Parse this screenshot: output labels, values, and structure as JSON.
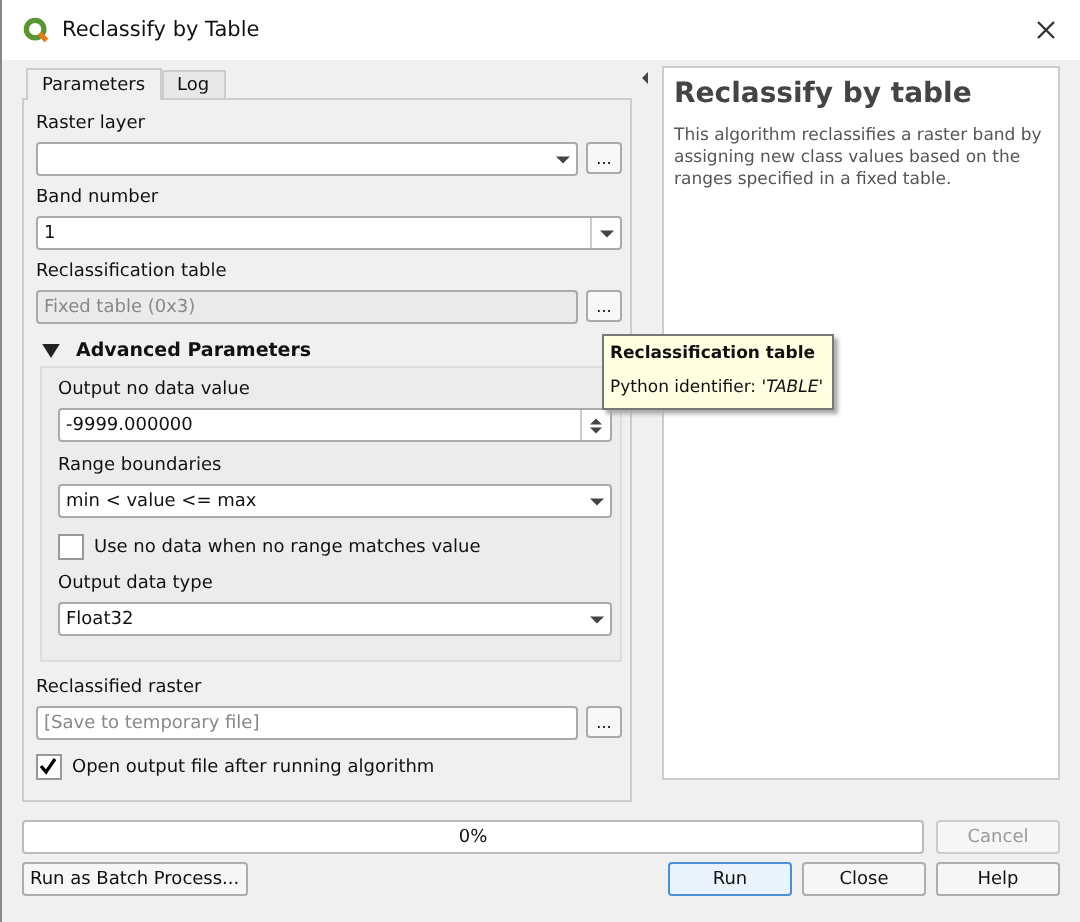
{
  "window": {
    "title": "Reclassify by Table"
  },
  "tabs": [
    {
      "label": "Parameters",
      "selected": true
    },
    {
      "label": "Log",
      "selected": false
    }
  ],
  "parameters": [
    {
      "kind": "combo",
      "label": "Raster layer",
      "browse": "..."
    },
    {
      "kind": "combo",
      "label": "Band number",
      "value": "1"
    },
    {
      "kind": "text",
      "label": "Reclassification table",
      "placeholder": "Fixed table (0x3)",
      "browse": "..."
    }
  ],
  "advanced": {
    "title": "Advanced Parameters",
    "expanded": true,
    "items": [
      {
        "kind": "spin",
        "label": "Output no data value",
        "value": "-9999.000000"
      },
      {
        "kind": "combo",
        "label": "Range boundaries",
        "value": "min < value <= max"
      },
      {
        "kind": "check",
        "label": "Use no data when no range matches value",
        "checked": false
      },
      {
        "kind": "combo",
        "label": "Output data type",
        "value": "Float32"
      }
    ]
  },
  "output": {
    "label": "Reclassified raster",
    "placeholder": "[Save to temporary file]",
    "browse": "..."
  },
  "open_output": {
    "label": "Open output file after running algorithm",
    "checked": true
  },
  "help": {
    "title": "Reclassify by table",
    "text": "This algorithm reclassifies a raster band by assigning new class values based on the ranges specified in a fixed table."
  },
  "tooltip": {
    "title": "Reclassification table",
    "text": "Python identifier: *'TABLE'*"
  },
  "progress": {
    "level": 0,
    "reading": "0%"
  },
  "buttons": [
    {
      "label": "Cancel",
      "disabled": true,
      "default": false
    },
    {
      "label": "Run as Batch Process...",
      "disabled": false,
      "default": false
    },
    {
      "label": "Run",
      "disabled": false,
      "default": true
    },
    {
      "label": "Close",
      "disabled": false,
      "default": false
    },
    {
      "label": "Help",
      "disabled": false,
      "default": false
    }
  ]
}
